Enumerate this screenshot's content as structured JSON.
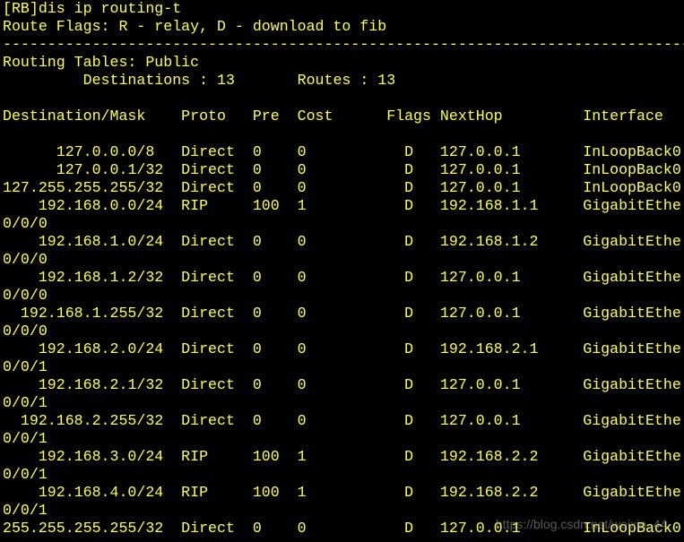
{
  "terminal": {
    "background": "#000000",
    "foreground": "#ffff4e",
    "lines": [
      "[RB]dis ip routing-t",
      "Route Flags: R - relay, D - download to fib",
      "------------------------------------------------------------------------------",
      "Routing Tables: Public",
      "         Destinations : 13       Routes : 13",
      "",
      "Destination/Mask    Proto   Pre  Cost      Flags NextHop         Interface",
      "",
      "      127.0.0.0/8   Direct  0    0           D   127.0.0.1       InLoopBack0",
      "      127.0.0.1/32  Direct  0    0           D   127.0.0.1       InLoopBack0",
      "127.255.255.255/32  Direct  0    0           D   127.0.0.1       InLoopBack0",
      "    192.168.0.0/24  RIP     100  1           D   192.168.1.1     GigabitEthe",
      "0/0/0",
      "    192.168.1.0/24  Direct  0    0           D   192.168.1.2     GigabitEthe",
      "0/0/0",
      "    192.168.1.2/32  Direct  0    0           D   127.0.0.1       GigabitEthe",
      "0/0/0",
      "  192.168.1.255/32  Direct  0    0           D   127.0.0.1       GigabitEthe",
      "0/0/0",
      "    192.168.2.0/24  Direct  0    0           D   192.168.2.1     GigabitEthe",
      "0/0/1",
      "    192.168.2.1/32  Direct  0    0           D   127.0.0.1       GigabitEthe",
      "0/0/1",
      "  192.168.2.255/32  Direct  0    0           D   127.0.0.1       GigabitEthe",
      "0/0/1",
      "    192.168.3.0/24  RIP     100  1           D   192.168.2.2     GigabitEthe",
      "0/0/1",
      "    192.168.4.0/24  RIP     100  1           D   192.168.2.2     GigabitEthe",
      "0/0/1",
      "255.255.255.255/32  Direct  0    0           D   127.0.0.1       InLoopBack0"
    ],
    "watermark": "https://blog.csdn.net/weixin_44..."
  }
}
